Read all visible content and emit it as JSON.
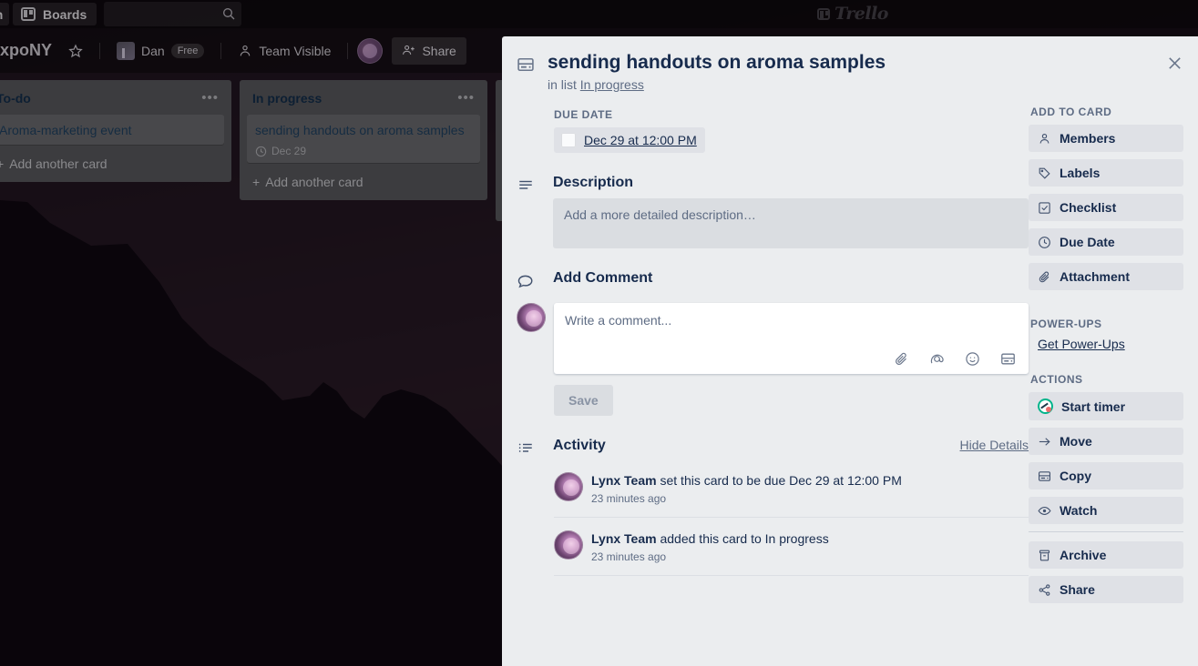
{
  "topnav": {
    "home_label": "n",
    "boards_label": "Boards",
    "search_placeholder": "",
    "search_value": "",
    "search_icon": "search-icon",
    "logo_text": "Trello"
  },
  "boardheader": {
    "title": "ExpoNY",
    "star_icon": "star-icon",
    "team_name": "Dan",
    "plan_badge": "Free",
    "visibility": "Team Visible",
    "visibility_icon": "team-visible-icon",
    "share_label": "Share",
    "share_icon": "share-person-icon"
  },
  "board": {
    "lists": [
      {
        "title": "To-do",
        "menu_icon": "ellipsis-icon",
        "cards": [
          {
            "title": "Aroma-marketing event",
            "due": null
          }
        ],
        "add_card_label": "Add another card"
      },
      {
        "title": "In progress",
        "menu_icon": "ellipsis-icon",
        "cards": [
          {
            "title": "sending handouts on aroma samples",
            "due": "Dec 29",
            "due_icon": "clock-icon"
          }
        ],
        "add_card_label": "Add another card"
      },
      {
        "title": "",
        "menu_icon": "ellipsis-icon",
        "cards": [],
        "add_card_label": ""
      }
    ]
  },
  "card_detail": {
    "close_icon": "close-icon",
    "card_icon": "card-icon",
    "title": "sending handouts on aroma samples",
    "in_list_prefix": "in list",
    "in_list_name": "In progress",
    "due_date": {
      "label": "DUE DATE",
      "value": "Dec 29 at 12:00 PM",
      "checked": false
    },
    "description": {
      "icon": "description-lines-icon",
      "title": "Description",
      "placeholder": "Add a more detailed description…",
      "value": ""
    },
    "add_comment": {
      "icon": "comment-bubble-icon",
      "title": "Add Comment",
      "placeholder": "Write a comment...",
      "value": "",
      "icons": [
        "paperclip-icon",
        "mention-at-icon",
        "emoji-icon",
        "card-template-icon"
      ],
      "save_label": "Save"
    },
    "activity": {
      "icon": "activity-list-icon",
      "title": "Activity",
      "hide_details_label": "Hide Details",
      "items": [
        {
          "author": "Lynx Team",
          "text": " set this card to be due Dec 29 at 12:00 PM",
          "time": "23 minutes ago"
        },
        {
          "author": "Lynx Team",
          "text": " added this card to In progress",
          "time": "23 minutes ago"
        }
      ]
    },
    "sidebar": {
      "add_to_card_label": "ADD TO CARD",
      "add_to_card": [
        {
          "label": "Members",
          "icon": "member-icon"
        },
        {
          "label": "Labels",
          "icon": "label-tag-icon"
        },
        {
          "label": "Checklist",
          "icon": "checklist-icon"
        },
        {
          "label": "Due Date",
          "icon": "clock-icon"
        },
        {
          "label": "Attachment",
          "icon": "paperclip-icon"
        }
      ],
      "powerups_label": "POWER-UPS",
      "get_powerups_label": "Get Power-Ups",
      "actions_label": "ACTIONS",
      "actions": [
        {
          "label": "Start timer",
          "icon": "toggl-timer-icon"
        },
        {
          "label": "Move",
          "icon": "arrow-right-icon"
        },
        {
          "label": "Copy",
          "icon": "card-icon"
        },
        {
          "label": "Watch",
          "icon": "eye-icon"
        }
      ],
      "actions_secondary": [
        {
          "label": "Archive",
          "icon": "archive-box-icon"
        },
        {
          "label": "Share",
          "icon": "share-nodes-icon"
        }
      ]
    }
  },
  "colors": {
    "panel_bg": "#ebedef",
    "text_primary": "#172b4d",
    "text_muted": "#5e6c84",
    "button_bg": "#dfe1e6",
    "timer_accent": "#00b38a"
  }
}
